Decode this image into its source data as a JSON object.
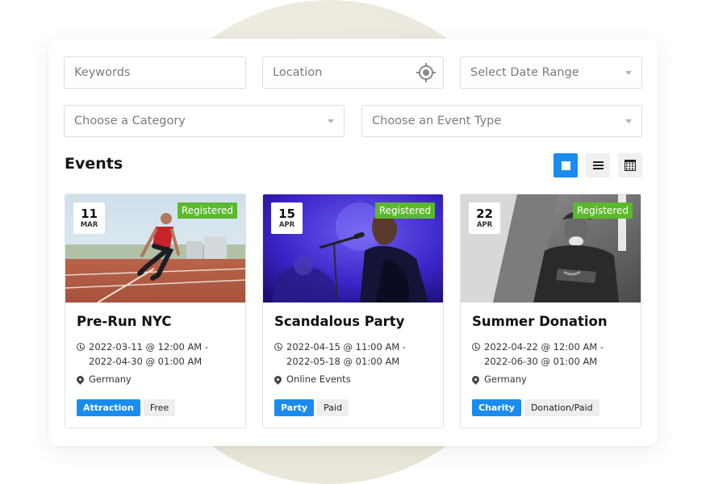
{
  "filters": {
    "keywords_placeholder": "Keywords",
    "location_placeholder": "Location",
    "date_placeholder": "Select Date Range",
    "category_placeholder": "Choose a Category",
    "event_type_placeholder": "Choose an Event Type"
  },
  "section": {
    "title": "Events"
  },
  "view_modes": [
    "grid",
    "list",
    "calendar"
  ],
  "active_view": "grid",
  "colors": {
    "accent": "#1a8cf0",
    "registered": "#5cb82e"
  },
  "events": [
    {
      "day": "11",
      "month": "MAR",
      "badge": "Registered",
      "title": "Pre-Run NYC",
      "time_line1": "2022-03-11 @ 12:00 AM -",
      "time_line2": "2022-04-30 @ 01:00 AM",
      "location": "Germany",
      "tag_primary": "Attraction",
      "tag_secondary": "Free"
    },
    {
      "day": "15",
      "month": "APR",
      "badge": "Registered",
      "title": "Scandalous Party",
      "time_line1": "2022-04-15 @ 11:00 AM -",
      "time_line2": "2022-05-18 @ 01:00 AM",
      "location": "Online Events",
      "tag_primary": "Party",
      "tag_secondary": "Paid"
    },
    {
      "day": "22",
      "month": "APR",
      "badge": "Registered",
      "title": "Summer Donation",
      "time_line1": "2022-04-22 @ 12:00 AM -",
      "time_line2": "2022-06-30 @ 01:00 AM",
      "location": "Germany",
      "tag_primary": "Charity",
      "tag_secondary": "Donation/Paid"
    }
  ]
}
